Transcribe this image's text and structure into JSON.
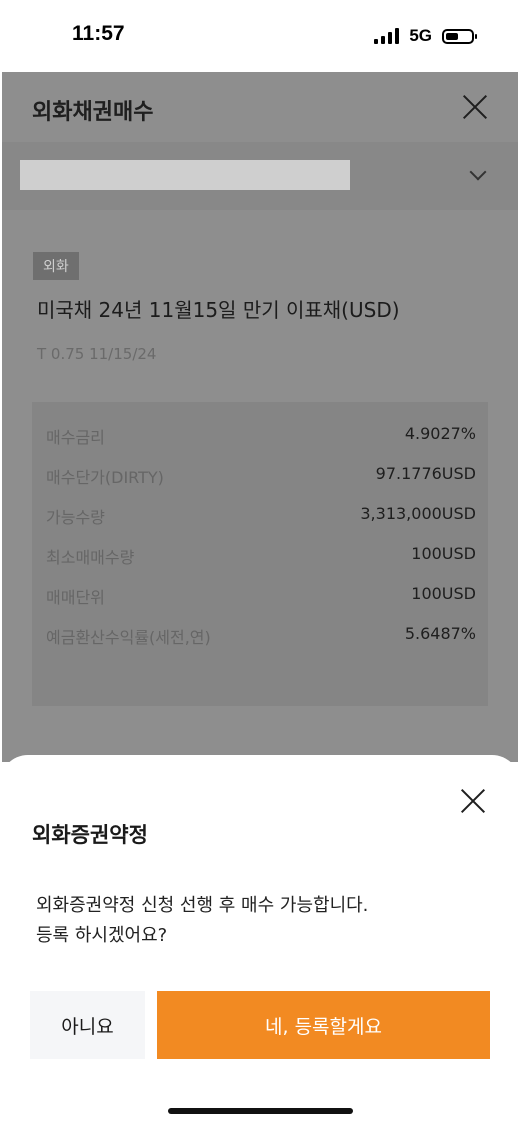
{
  "status_bar": {
    "time": "11:57",
    "network": "5G",
    "icons": [
      "signal-icon",
      "battery-icon"
    ]
  },
  "header": {
    "title": "외화채권매수",
    "close_icon": "close-icon"
  },
  "account_select": {
    "chevron_icon": "chevron-down-icon"
  },
  "bond": {
    "badge": "외화",
    "name": "미국채 24년 11월15일 만기 이표채(USD)",
    "code": "T 0.75 11/15/24"
  },
  "info_rows": [
    {
      "label": "매수금리",
      "value": "4.9027%"
    },
    {
      "label": "매수단가(DIRTY)",
      "value": "97.1776USD"
    },
    {
      "label": "가능수량",
      "value": "3,313,000USD"
    },
    {
      "label": "최소매매수량",
      "value": "100USD"
    },
    {
      "label": "매매단위",
      "value": "100USD"
    },
    {
      "label": "예금환산수익률(세전,연)",
      "value": "5.6487%"
    }
  ],
  "sheet": {
    "title": "외화증권약정",
    "message_line1": "외화증권약정 신청 선행 후 매수 가능합니다.",
    "message_line2": "등록 하시겠어요?",
    "no_label": "아니요",
    "yes_label": "네, 등록할게요"
  },
  "colors": {
    "accent": "#f28a22",
    "overlay": "#8e8e8e"
  }
}
